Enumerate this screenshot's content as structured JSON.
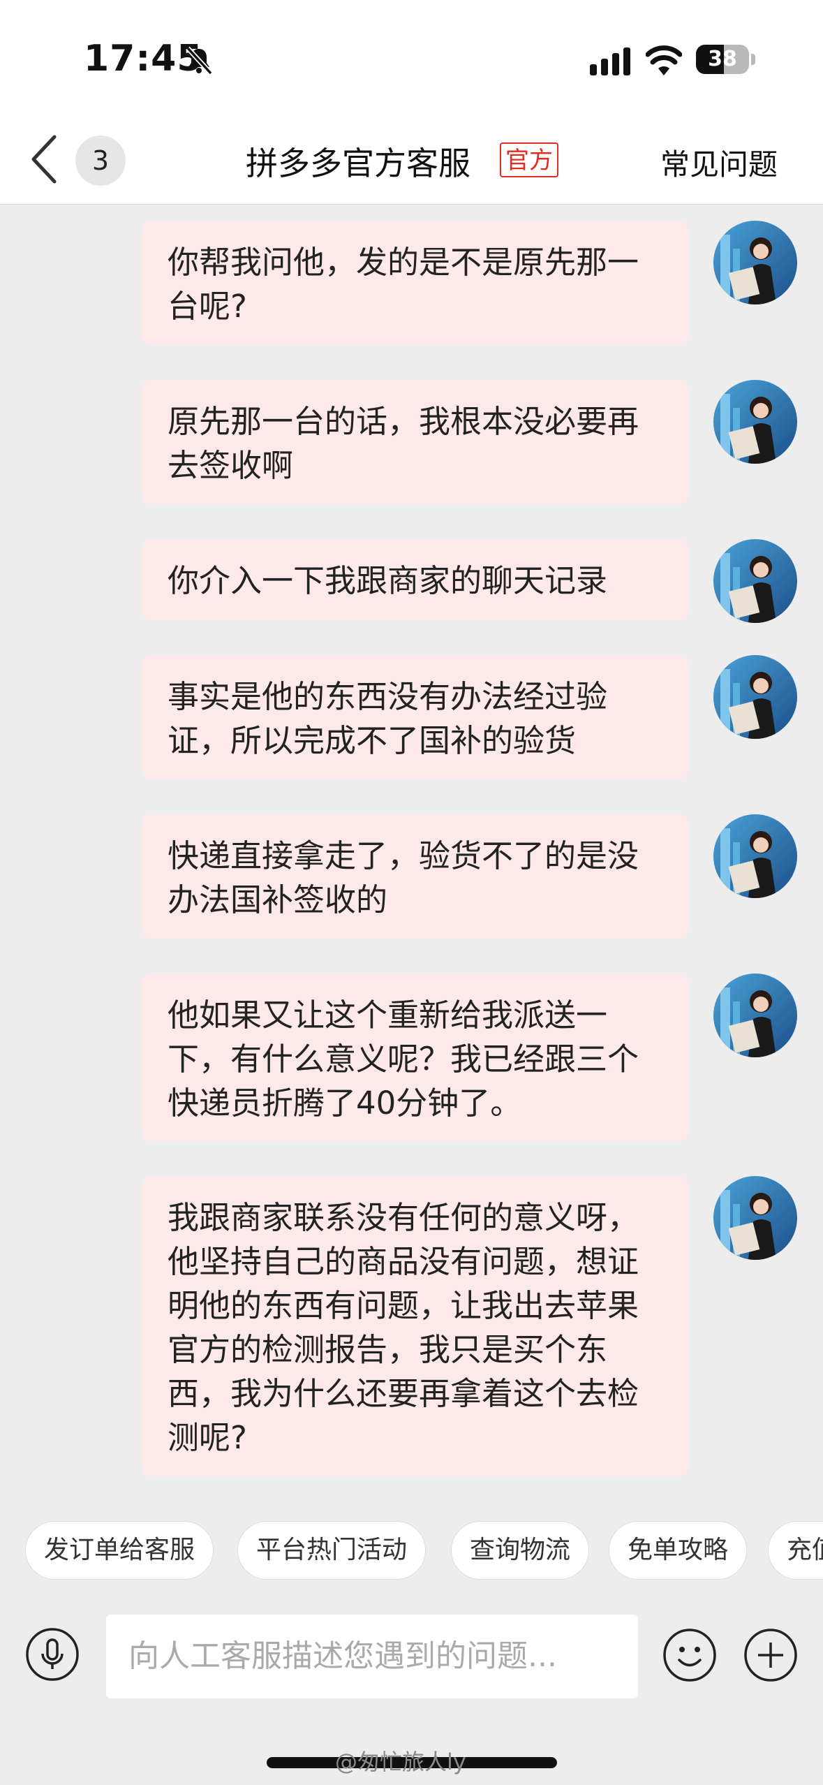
{
  "status_bar": {
    "time": "17:45",
    "battery": "38"
  },
  "header": {
    "back_icon": "chevron-left-icon",
    "unread_count": "3",
    "title": "拼多多官方客服",
    "official_tag": "官方",
    "faq": "常见问题",
    "accent_color": "#e02e24"
  },
  "messages": [
    {
      "text": "你帮我问他，发的是不是原先那一台呢?"
    },
    {
      "text": "原先那一台的话，我根本没必要再去签收啊"
    },
    {
      "text": "你介入一下我跟商家的聊天记录"
    },
    {
      "text": "事实是他的东西没有办法经过验证，所以完成不了国补的验货"
    },
    {
      "text": "快递直接拿走了，验货不了的是没办法国补签收的"
    },
    {
      "text": "他如果又让这个重新给我派送一下，有什么意义呢？我已经跟三个快递员折腾了40分钟了。"
    },
    {
      "text": "我跟商家联系没有任何的意义呀，他坚持自己的商品没有问题，想证明他的东西有问题，让我出去苹果官方的检测报告，我只是买个东西，我为什么还要再拿着这个去检测呢?"
    }
  ],
  "quick_actions": [
    {
      "label": "发订单给客服"
    },
    {
      "label": "平台热门活动"
    },
    {
      "label": "查询物流"
    },
    {
      "label": "免单攻略"
    },
    {
      "label": "充值"
    }
  ],
  "input": {
    "placeholder": "向人工客服描述您遇到的问题..."
  },
  "icons": {
    "mic": "microphone-icon",
    "emoji": "emoji-icon",
    "plus": "plus-icon"
  },
  "watermark": "@匆忙旅人ly"
}
